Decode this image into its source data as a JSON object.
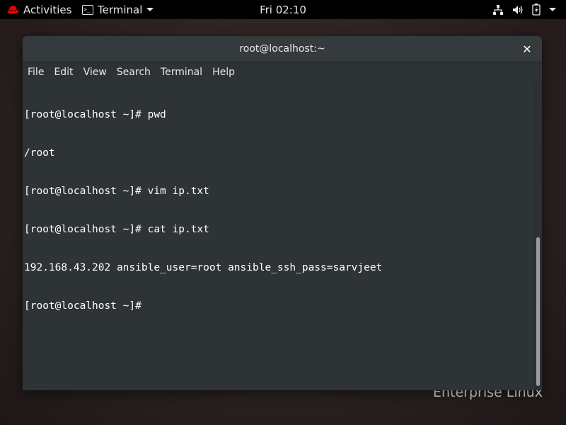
{
  "topbar": {
    "activities_label": "Activities",
    "app_menu_label": "Terminal",
    "clock": "Fri 02:10",
    "icons": [
      "network-icon",
      "volume-icon",
      "battery-icon",
      "system-menu-icon"
    ]
  },
  "desktop": {
    "brand_text": "Enterprise Linux"
  },
  "window": {
    "title": "root@localhost:~",
    "close_glyph": "✕",
    "menu": [
      "File",
      "Edit",
      "View",
      "Search",
      "Terminal",
      "Help"
    ]
  },
  "terminal": {
    "lines": [
      "[root@localhost ~]# pwd",
      "/root",
      "[root@localhost ~]# vim ip.txt",
      "[root@localhost ~]# cat ip.txt",
      "192.168.43.202 ansible_user=root ansible_ssh_pass=sarvjeet",
      "[root@localhost ~]# "
    ]
  },
  "colors": {
    "topbar_bg": "#000000",
    "terminal_bg": "#2e3436",
    "terminal_fg": "#ffffff",
    "redhat_red": "#ee0000"
  }
}
